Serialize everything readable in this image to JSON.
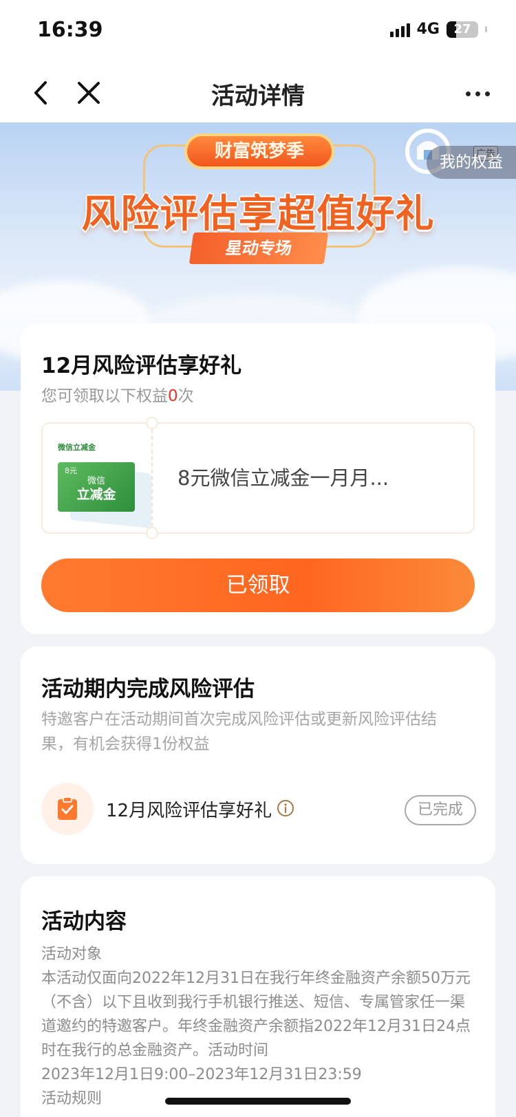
{
  "status": {
    "time": "16:39",
    "network": "4G",
    "battery": "27"
  },
  "nav": {
    "title": "活动详情"
  },
  "banner": {
    "pill": "财富筑梦季",
    "headline": "风险评估享超值好礼",
    "ribbon": "星动专场",
    "ad_tag": "广告",
    "my_benefits": "我的权益"
  },
  "reward_card": {
    "title": "12月风险评估享好礼",
    "sub_prefix": "您可领取以下权益",
    "sub_count": "0",
    "sub_suffix": "次",
    "coupon": {
      "small_label": "微信立减金",
      "amount": "8元",
      "card_top": "微信",
      "card_main": "立减金",
      "name": "8元微信立减金一月月..."
    },
    "button": "已领取"
  },
  "task_card": {
    "title": "活动期内完成风险评估",
    "desc": "特邀客户在活动期间首次完成风险评估或更新风险评估结果，有机会获得1份权益",
    "task_name": "12月风险评估享好礼",
    "status": "已完成"
  },
  "content_card": {
    "title": "活动内容",
    "lines": [
      "活动对象",
      "本活动仅面向2022年12月31日在我行年终金融资产余额50万元（不含）以下且收到我行手机银行推送、短信、专属管家任一渠道邀约的特邀客户。年终金融资产余额指2022年12月31日24点时在我行的总金融资产。活动时间",
      "2023年12月1日9:00–2023年12月31日23:59",
      "活动规则"
    ]
  },
  "colors": {
    "accent": "#ff6a25",
    "count_red": "#e8352a",
    "coupon_green": "#2f8e3b"
  }
}
